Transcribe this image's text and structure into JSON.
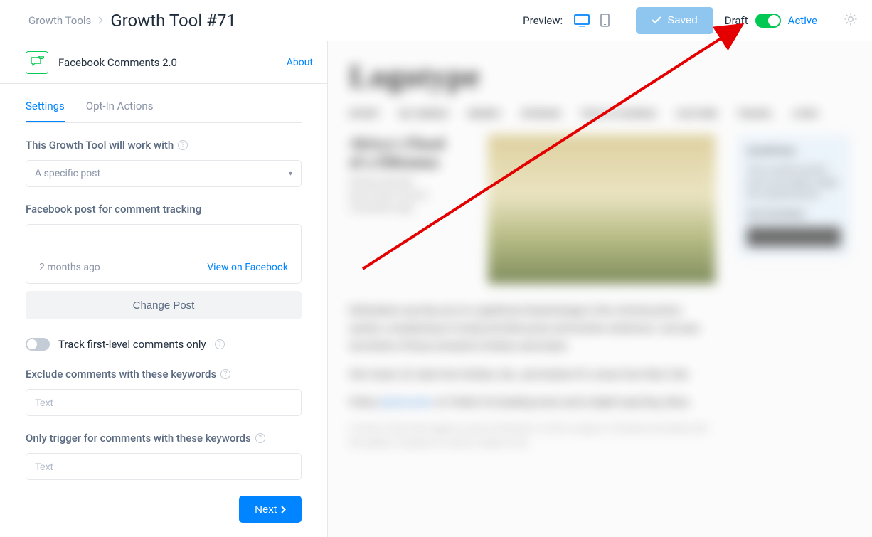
{
  "breadcrumb": {
    "parent": "Growth Tools",
    "title": "Growth Tool #71"
  },
  "topbar": {
    "preview_label": "Preview:",
    "saved_label": "Saved",
    "draft_label": "Draft",
    "active_label": "Active",
    "toggle_on": true
  },
  "tool": {
    "name": "Facebook Comments 2.0",
    "about": "About"
  },
  "tabs": {
    "settings": "Settings",
    "optin": "Opt-In Actions",
    "active": "settings"
  },
  "form": {
    "work_with_label": "This Growth Tool will work with",
    "work_with_value": "A specific post",
    "post_label": "Facebook post for comment tracking",
    "post_time": "2 months ago",
    "view_fb": "View on Facebook",
    "change_post": "Change Post",
    "track_first_level": "Track first-level comments only",
    "exclude_label": "Exclude comments with these keywords",
    "exclude_placeholder": "Text",
    "only_trigger_label": "Only trigger for comments with these keywords",
    "only_trigger_placeholder": "Text",
    "next": "Next"
  },
  "colors": {
    "primary": "#0084ff",
    "success": "#00c853"
  }
}
